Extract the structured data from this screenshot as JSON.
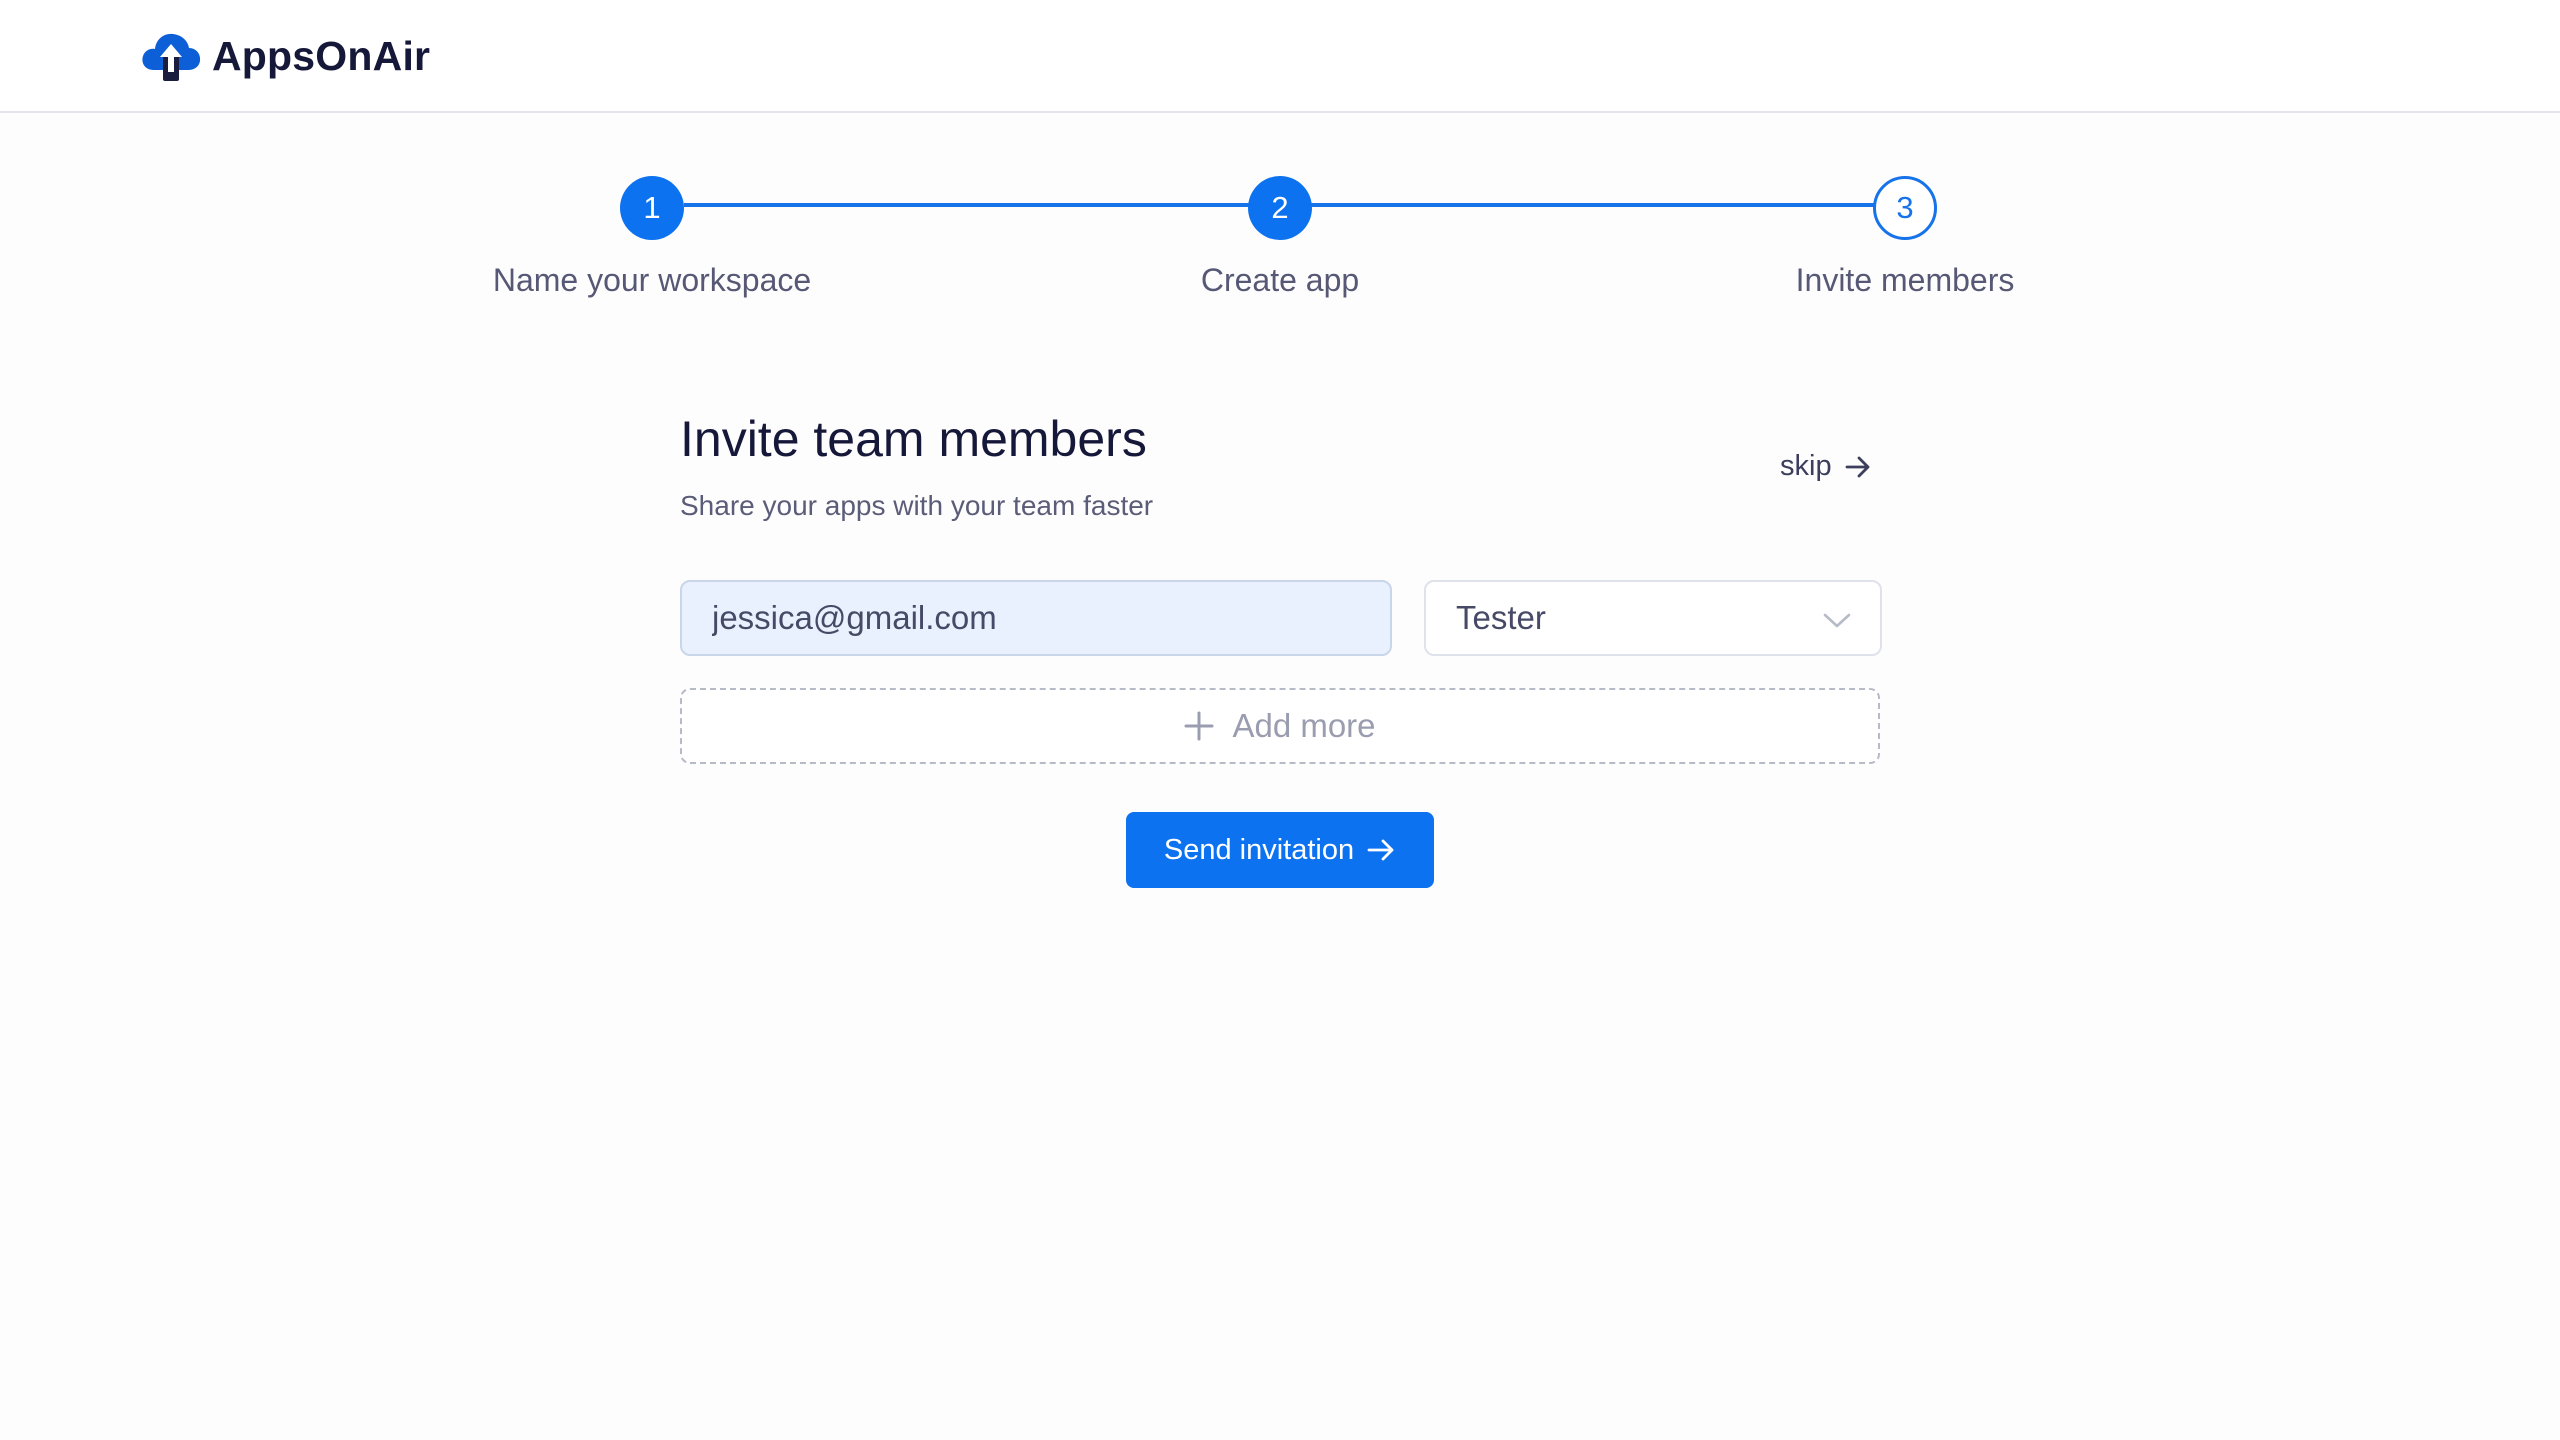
{
  "app": {
    "name": "AppsOnAir",
    "logo_icon": "cloud-upload-icon"
  },
  "stepper": {
    "steps": [
      {
        "number": "1",
        "label": "Name your workspace",
        "state": "done"
      },
      {
        "number": "2",
        "label": "Create app",
        "state": "done"
      },
      {
        "number": "3",
        "label": "Invite members",
        "state": "current"
      }
    ]
  },
  "form": {
    "title": "Invite team members",
    "subtitle": "Share your apps with your team faster",
    "skip_label": "skip",
    "email_value": "jessica@gmail.com",
    "role_value": "Tester",
    "add_more_label": "Add more",
    "send_label": "Send invitation"
  },
  "colors": {
    "accent": "#0d72f0",
    "text_dark": "#16183a",
    "text_muted": "#565875",
    "input_bg": "#e8f1fd"
  }
}
